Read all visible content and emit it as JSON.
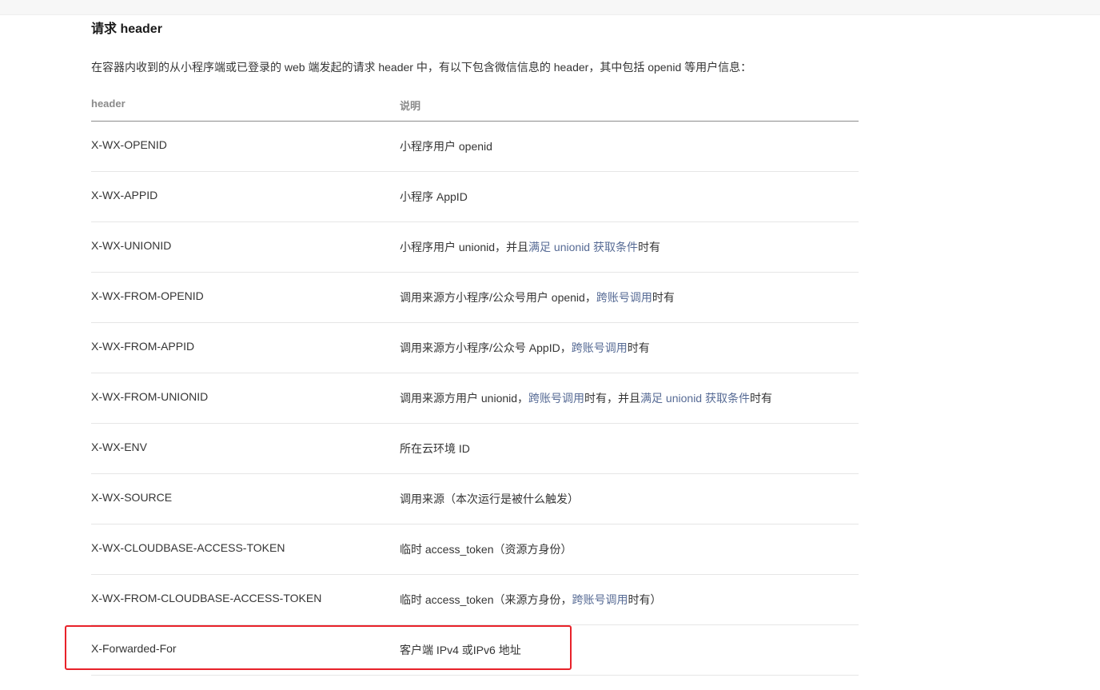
{
  "section": {
    "title": "请求 header",
    "intro": "在容器内收到的从小程序端或已登录的 web 端发起的请求 header 中，有以下包含微信信息的 header，其中包括 openid 等用户信息："
  },
  "table": {
    "headers": [
      "header",
      "说明"
    ],
    "rows": [
      {
        "name": "X-WX-OPENID",
        "desc": [
          {
            "t": "小程序用户 openid"
          }
        ]
      },
      {
        "name": "X-WX-APPID",
        "desc": [
          {
            "t": "小程序 AppID"
          }
        ]
      },
      {
        "name": "X-WX-UNIONID",
        "desc": [
          {
            "t": "小程序用户 unionid，并且"
          },
          {
            "t": "满足 unionid 获取条件",
            "link": true
          },
          {
            "t": "时有"
          }
        ]
      },
      {
        "name": "X-WX-FROM-OPENID",
        "desc": [
          {
            "t": "调用来源方小程序/公众号用户 openid，"
          },
          {
            "t": "跨账号调用",
            "link": true
          },
          {
            "t": "时有"
          }
        ]
      },
      {
        "name": "X-WX-FROM-APPID",
        "desc": [
          {
            "t": "调用来源方小程序/公众号 AppID，"
          },
          {
            "t": "跨账号调用",
            "link": true
          },
          {
            "t": "时有"
          }
        ]
      },
      {
        "name": "X-WX-FROM-UNIONID",
        "desc": [
          {
            "t": "调用来源方用户 unionid，"
          },
          {
            "t": "跨账号调用",
            "link": true
          },
          {
            "t": "时有，并且"
          },
          {
            "t": "满足 unionid 获取条件",
            "link": true
          },
          {
            "t": "时有"
          }
        ]
      },
      {
        "name": "X-WX-ENV",
        "desc": [
          {
            "t": "所在云环境 ID"
          }
        ]
      },
      {
        "name": "X-WX-SOURCE",
        "desc": [
          {
            "t": "调用来源（本次运行是被什么触发）"
          }
        ]
      },
      {
        "name": "X-WX-CLOUDBASE-ACCESS-TOKEN",
        "desc": [
          {
            "t": "临时 access_token（资源方身份）"
          }
        ]
      },
      {
        "name": "X-WX-FROM-CLOUDBASE-ACCESS-TOKEN",
        "desc": [
          {
            "t": "临时 access_token（来源方身份，"
          },
          {
            "t": "跨账号调用",
            "link": true
          },
          {
            "t": "时有）"
          }
        ]
      },
      {
        "name": "X-Forwarded-For",
        "desc": [
          {
            "t": "客户端 IPv4 或IPv6 地址"
          }
        ],
        "highlighted": true
      }
    ]
  },
  "colors": {
    "link": "#576b95",
    "highlight_border": "#e8222a",
    "text": "#353535"
  }
}
